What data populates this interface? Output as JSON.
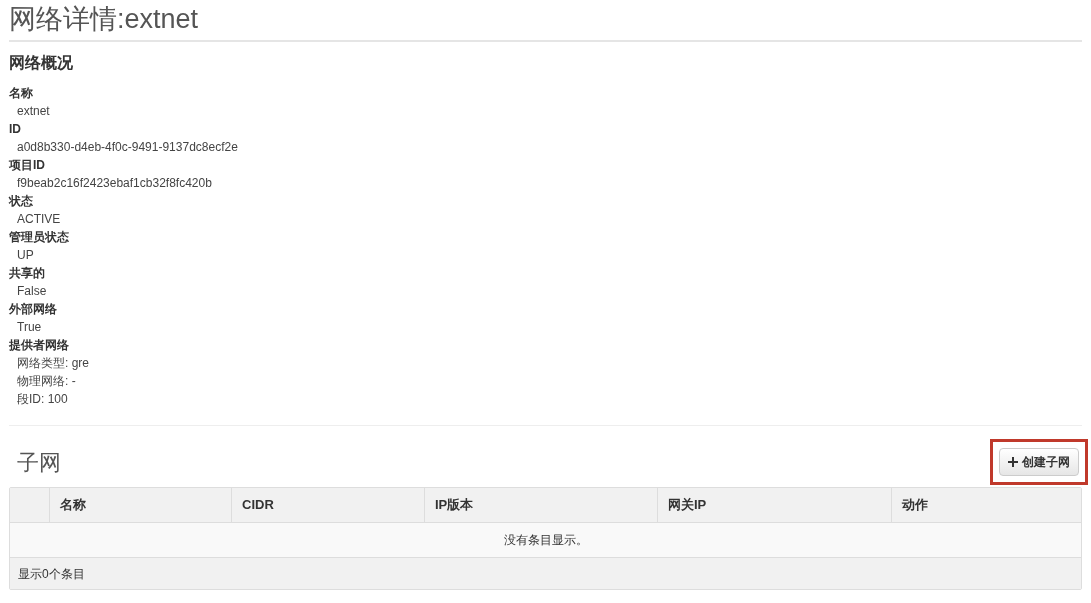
{
  "page_title": "网络详情:extnet",
  "overview": {
    "heading": "网络概况",
    "fields": [
      {
        "label": "名称",
        "values": [
          "extnet"
        ]
      },
      {
        "label": "ID",
        "values": [
          "a0d8b330-d4eb-4f0c-9491-9137dc8ecf2e"
        ]
      },
      {
        "label": "项目ID",
        "values": [
          "f9beab2c16f2423ebaf1cb32f8fc420b"
        ]
      },
      {
        "label": "状态",
        "values": [
          "ACTIVE"
        ]
      },
      {
        "label": "管理员状态",
        "values": [
          "UP"
        ]
      },
      {
        "label": "共享的",
        "values": [
          "False"
        ]
      },
      {
        "label": "外部网络",
        "values": [
          "True"
        ]
      },
      {
        "label": "提供者网络",
        "values": [
          "网络类型: gre",
          "物理网络: -",
          "段ID: 100"
        ]
      }
    ]
  },
  "subnets": {
    "heading": "子网",
    "create_button": {
      "label": "创建子网",
      "highlighted": true
    },
    "table": {
      "columns": [
        "名称",
        "CIDR",
        "IP版本",
        "网关IP",
        "动作"
      ],
      "empty_message": "没有条目显示。",
      "footer": "显示0个条目"
    }
  }
}
